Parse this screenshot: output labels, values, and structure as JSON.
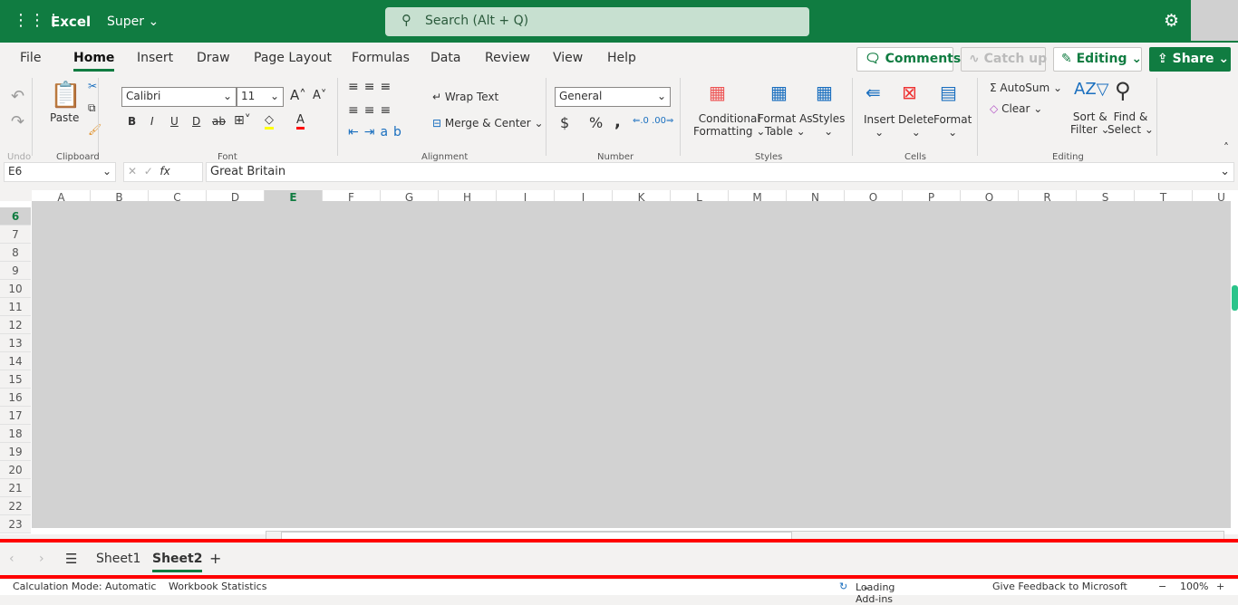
{
  "header": {
    "app_name": "Excel",
    "doc_name": "Super",
    "search_placeholder": "Search (Alt + Q)",
    "waffle_icon": "waffle-icon",
    "settings_icon": "gear-icon"
  },
  "menu": {
    "items": [
      "File",
      "Home",
      "Insert",
      "Draw",
      "Page Layout",
      "Formulas",
      "Data",
      "Review",
      "View",
      "Help"
    ],
    "active": "Home"
  },
  "actions": {
    "comments": "Comments",
    "catch_up": "Catch up",
    "editing": "Editing",
    "share": "Share"
  },
  "ribbon": {
    "undo_group": "Undo",
    "clipboard": {
      "paste": "Paste",
      "group": "Clipboard"
    },
    "font": {
      "name": "Calibri",
      "size": "11",
      "group": "Font",
      "bold": "B",
      "italic": "I",
      "underline": "U",
      "double_underline": "D",
      "strike": "ab",
      "font_color_letter": "A",
      "highlight_color": "#ffff00",
      "font_color": "#ff0000"
    },
    "alignment": {
      "wrap_text": "Wrap Text",
      "merge_center": "Merge & Center",
      "group": "Alignment"
    },
    "number": {
      "format": "General",
      "currency": "$",
      "percent": "%",
      "comma": ",",
      "group": "Number"
    },
    "styles": {
      "conditional": "Conditional",
      "formatting": "Formatting",
      "format_as": "Format As",
      "table": "Table",
      "styles": "Styles",
      "group": "Styles"
    },
    "cells": {
      "insert": "Insert",
      "delete": "Delete",
      "format": "Format",
      "group": "Cells"
    },
    "editing": {
      "autosum": "AutoSum",
      "clear": "Clear",
      "sort1": "Sort &",
      "sort2": "Filter",
      "find1": "Find &",
      "find2": "Select",
      "group": "Editing"
    }
  },
  "formula_bar": {
    "name_box": "E6",
    "fx": "fx",
    "value": "Great Britain"
  },
  "grid": {
    "columns": [
      "A",
      "B",
      "C",
      "D",
      "E",
      "F",
      "G",
      "H",
      "I",
      "J",
      "K",
      "L",
      "M",
      "N",
      "O",
      "P",
      "Q",
      "R",
      "S",
      "T",
      "U"
    ],
    "rows": [
      "6",
      "7",
      "8",
      "9",
      "10",
      "11",
      "12",
      "13",
      "14",
      "15",
      "16",
      "17",
      "18",
      "19",
      "20",
      "21",
      "22",
      "23"
    ],
    "selected_column": "E",
    "selected_row": "6"
  },
  "sheets": {
    "tabs": [
      "Sheet1",
      "Sheet2"
    ],
    "active": "Sheet2",
    "add": "+"
  },
  "status": {
    "calc": "Calculation Mode: Automatic",
    "stats": "Workbook Statistics",
    "addins": "Loading Add-ins",
    "feedback": "Give Feedback to Microsoft",
    "zoom": "100%",
    "zoom_out": "−",
    "zoom_in": "+"
  },
  "colors": {
    "brand": "#107c41",
    "annotation_red": "#ff0000"
  }
}
